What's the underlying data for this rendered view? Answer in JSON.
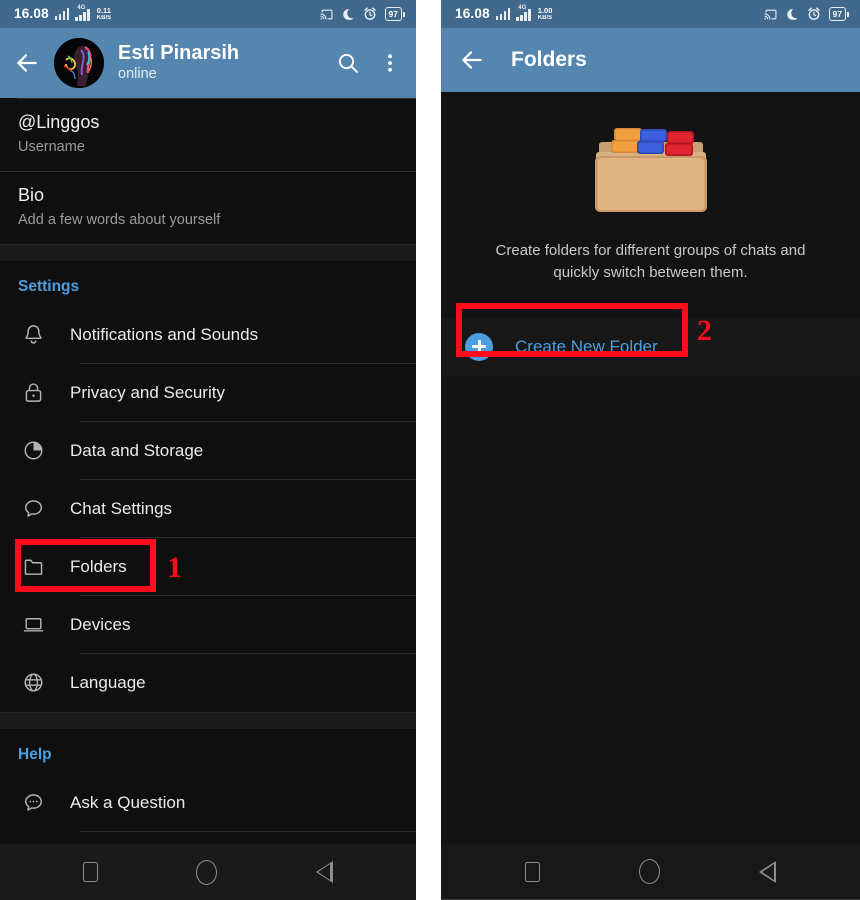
{
  "status_bar": {
    "time": "16.08",
    "network_label": "4G",
    "data_rate_value": "0.11",
    "data_rate_unit": "KB/S",
    "data_rate_value_right": "1.00",
    "battery": "97",
    "icons": [
      "cast-icon",
      "do-not-disturb-moon-icon",
      "alarm-clock-icon",
      "battery-icon"
    ]
  },
  "left_screen": {
    "app_bar": {
      "back": "back-arrow-icon",
      "contact_name": "Esti Pinarsih",
      "contact_status": "online",
      "search": "search-icon",
      "overflow": "more-vertical-icon"
    },
    "profile_rows": [
      {
        "title": "@Linggos",
        "subtitle": "Username"
      },
      {
        "title": "Bio",
        "subtitle": "Add a few words about yourself"
      }
    ],
    "settings_header": "Settings",
    "settings_items": [
      {
        "label": "Notifications and Sounds",
        "icon": "bell-icon"
      },
      {
        "label": "Privacy and Security",
        "icon": "lock-icon"
      },
      {
        "label": "Data and Storage",
        "icon": "pie-chart-icon"
      },
      {
        "label": "Chat Settings",
        "icon": "chat-bubble-icon"
      },
      {
        "label": "Folders",
        "icon": "folder-icon"
      },
      {
        "label": "Devices",
        "icon": "laptop-icon"
      },
      {
        "label": "Language",
        "icon": "globe-icon"
      }
    ],
    "help_header": "Help",
    "help_items": [
      {
        "label": "Ask a Question",
        "icon": "question-bubble-icon"
      }
    ]
  },
  "right_screen": {
    "app_bar": {
      "back": "back-arrow-icon",
      "title": "Folders"
    },
    "hero": {
      "illustration": "folders-stack-illustration",
      "description": "Create folders for different groups of chats and quickly switch between them."
    },
    "create_new_folder": {
      "icon": "plus-circle-icon",
      "label": "Create New Folder"
    }
  },
  "nav_bar": {
    "recents": "square-recents-icon",
    "home": "circle-home-icon",
    "back": "triangle-back-icon"
  },
  "annotations": [
    {
      "number": "1",
      "target": "Folders settings row"
    },
    {
      "number": "2",
      "target": "Create New Folder button"
    }
  ],
  "colors": {
    "status_bar": "#41688d",
    "app_bar": "#5486b0",
    "accent_blue": "#4b9fe0",
    "background": "#0f0f0f",
    "annotation_red": "#fc0d1b"
  }
}
